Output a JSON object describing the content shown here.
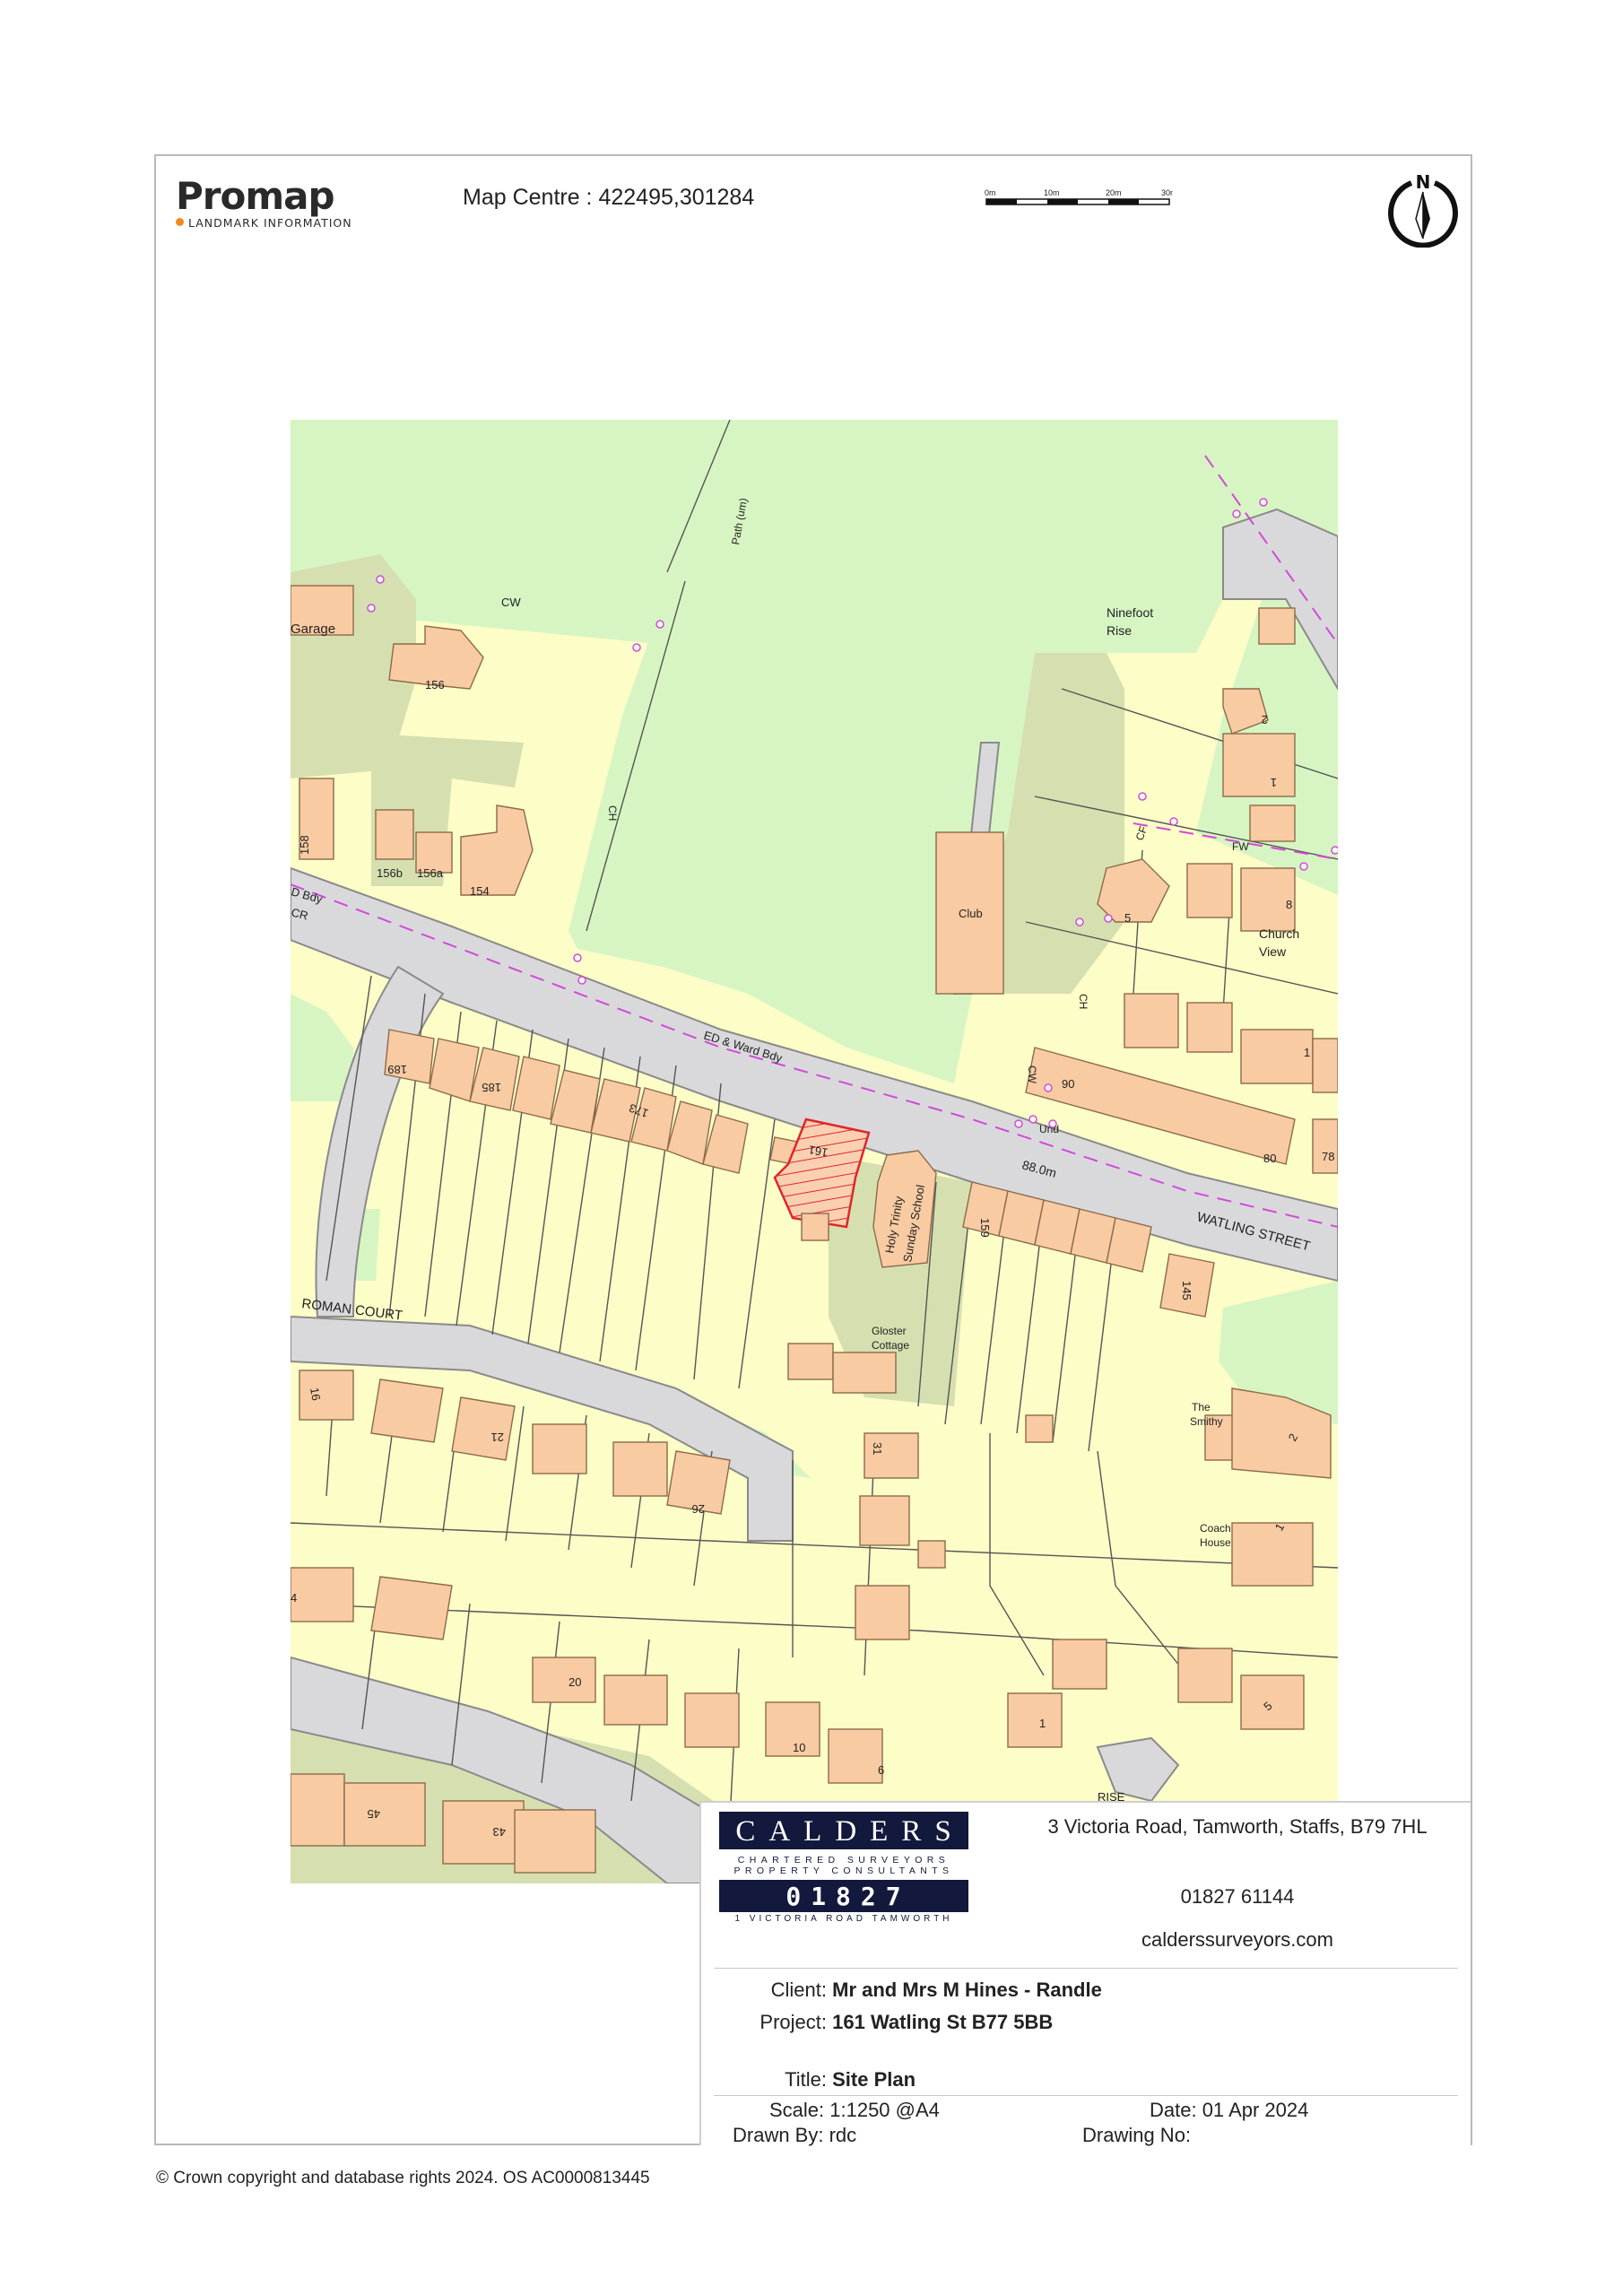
{
  "header": {
    "logo_word": "Promap",
    "logo_sub": "LANDMARK INFORMATION",
    "map_centre": "Map Centre : 422495,301284",
    "scale_ticks": [
      "0m",
      "10m",
      "20m",
      "30m"
    ],
    "north_label": "N"
  },
  "map": {
    "colors": {
      "field_green": "#d7f5c2",
      "garden_yellow": "#fdfdc8",
      "building_orange": "#f9cba2",
      "road_grey": "#d9d9dc",
      "verge_khaki": "#d6dfb0",
      "boundary_magenta": "#d24ad8",
      "site_red": "#e0262b"
    },
    "labels": {
      "garage": "Garage",
      "cw1": "CW",
      "n156": "156",
      "n158": "158",
      "n156b": "156b",
      "n156a": "156a",
      "n154": "154",
      "ch1": "CH",
      "path": "Path (um)",
      "ninefoot": "Ninefoot",
      "rise": "Rise",
      "n2a": "2",
      "n1a": "1",
      "cf": "CF",
      "fw": "FW",
      "club": "Club",
      "n5a": "5",
      "n8": "8",
      "church": "Church",
      "view": "View",
      "ch2": "CH",
      "cw2": "CW",
      "n1b": "1",
      "n90": "90",
      "n80": "80",
      "n78": "78",
      "und": "Und",
      "height": "88.0m",
      "watling": "WATLING STREET",
      "bdy": "D Bdy",
      "cr": "CR",
      "ed_ward": "ED & Ward Bdy",
      "n189": "189",
      "n185": "185",
      "n173": "173",
      "n161": "161",
      "sunday1": "Holy Trinity",
      "sunday2": "Sunday School",
      "n159": "159",
      "n145": "145",
      "gloster1": "Gloster",
      "gloster2": "Cottage",
      "roman": "ROMAN COURT",
      "n16": "16",
      "n21": "21",
      "n26": "26",
      "n31": "31",
      "smithy1": "The",
      "smithy2": "Smithy",
      "n2b": "2",
      "coach1": "Coach",
      "coach2": "House",
      "n1c": "1",
      "n4": "4",
      "n20": "20",
      "n10": "10",
      "n6": "6",
      "n1d": "1",
      "n5b": "5",
      "n45": "45",
      "n43": "43",
      "rise2": "RISE"
    }
  },
  "title_block": {
    "company_name": "CALDERS",
    "company_line1": "CHARTERED SURVEYORS",
    "company_line2": "PROPERTY CONSULTANTS",
    "company_phone": "01827 61144",
    "company_address_small": "1 VICTORIA ROAD TAMWORTH",
    "address": "3 Victoria Road, Tamworth, Staffs, B79 7HL",
    "phone": "01827 61144",
    "website": "calderssurveyors.com",
    "client_label": "Client:",
    "client_value": "Mr and Mrs M Hines - Randle",
    "project_label": "Project:",
    "project_value": "161 Watling St B77 5BB",
    "title_label": "Title:",
    "title_value": "Site Plan",
    "scale": "Scale: 1:1250 @A4",
    "date": "Date: 01 Apr 2024",
    "drawn_by": "Drawn By: rdc",
    "drawing_no": "Drawing No:"
  },
  "footer": {
    "copyright": "© Crown copyright and database rights 2024. OS AC0000813445"
  }
}
